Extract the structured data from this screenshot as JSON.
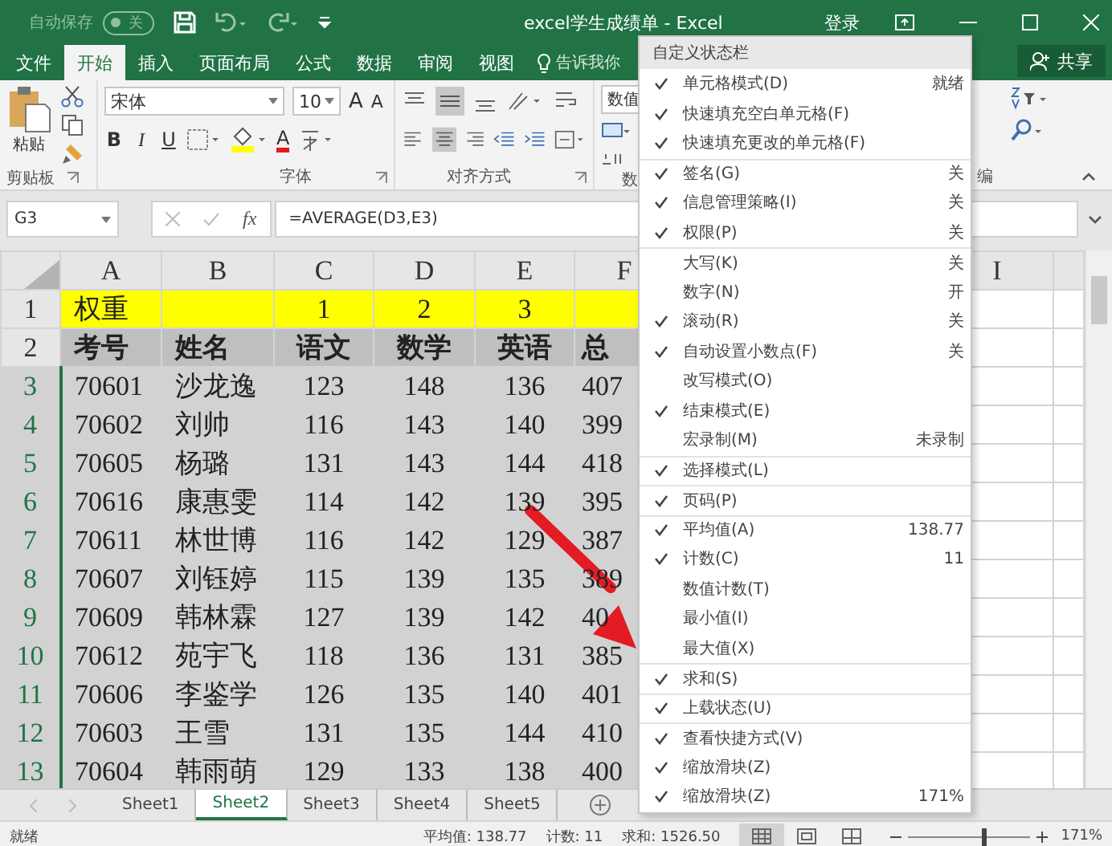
{
  "title_bar": {
    "autosave_label": "自动保存",
    "autosave_state": "关",
    "autosave_on": false,
    "title": "excel学生成绩单  -  Excel",
    "signin": "登录"
  },
  "ribbon_tabs": [
    {
      "label": "文件",
      "selected": false
    },
    {
      "label": "开始",
      "selected": true
    },
    {
      "label": "插入",
      "selected": false
    },
    {
      "label": "页面布局",
      "selected": false
    },
    {
      "label": "公式",
      "selected": false
    },
    {
      "label": "数据",
      "selected": false
    },
    {
      "label": "审阅",
      "selected": false
    },
    {
      "label": "视图",
      "selected": false
    }
  ],
  "tell_me": "告诉我你",
  "share": "共享",
  "ribbon": {
    "paste": "粘贴",
    "font_name": "宋体",
    "font_size": "10",
    "grow": "A",
    "shrink": "A",
    "format_buttons": [
      "B",
      "I",
      "U"
    ],
    "font_color": "A",
    "number_format": "数值",
    "groups": [
      "剪贴板",
      "字体",
      "对齐方式",
      "数"
    ],
    "edit_group": "编"
  },
  "formula_bar": {
    "name_box": "G3",
    "fx": "fx",
    "formula": "=AVERAGE(D3,E3)"
  },
  "sheet": {
    "columns": [
      "A",
      "B",
      "C",
      "D",
      "E",
      "F"
    ],
    "right_column": "I",
    "rows": [
      {
        "header": "1",
        "selected": false,
        "kind": "weight",
        "cells": [
          "权重",
          null,
          "1",
          "2",
          "3",
          null
        ]
      },
      {
        "header": "2",
        "selected": false,
        "kind": "heading",
        "cells": [
          "考号",
          "姓名",
          "语文",
          "数学",
          "英语",
          "总"
        ]
      },
      {
        "header": "3",
        "selected": true,
        "kind": "data",
        "cells": [
          "70601",
          "沙龙逸",
          "123",
          "148",
          "136",
          "407"
        ]
      },
      {
        "header": "4",
        "selected": true,
        "kind": "data",
        "cells": [
          "70602",
          "刘帅",
          "116",
          "143",
          "140",
          "399"
        ]
      },
      {
        "header": "5",
        "selected": true,
        "kind": "data",
        "cells": [
          "70605",
          "杨璐",
          "131",
          "143",
          "144",
          "418"
        ]
      },
      {
        "header": "6",
        "selected": true,
        "kind": "data",
        "cells": [
          "70616",
          "康惠雯",
          "114",
          "142",
          "139",
          "395"
        ]
      },
      {
        "header": "7",
        "selected": true,
        "kind": "data",
        "cells": [
          "70611",
          "林世博",
          "116",
          "142",
          "129",
          "387"
        ]
      },
      {
        "header": "8",
        "selected": true,
        "kind": "data",
        "cells": [
          "70607",
          "刘钰婷",
          "115",
          "139",
          "135",
          "389"
        ]
      },
      {
        "header": "9",
        "selected": true,
        "kind": "data",
        "cells": [
          "70609",
          "韩林霖",
          "127",
          "139",
          "142",
          "40"
        ]
      },
      {
        "header": "10",
        "selected": true,
        "kind": "data",
        "cells": [
          "70612",
          "苑宇飞",
          "118",
          "136",
          "131",
          "385"
        ]
      },
      {
        "header": "11",
        "selected": true,
        "kind": "data",
        "cells": [
          "70606",
          "李鉴学",
          "126",
          "135",
          "140",
          "401"
        ]
      },
      {
        "header": "12",
        "selected": true,
        "kind": "data",
        "cells": [
          "70603",
          "王雪",
          "131",
          "135",
          "144",
          "410"
        ]
      },
      {
        "header": "13",
        "selected": true,
        "kind": "data",
        "cells": [
          "70604",
          "韩雨萌",
          "129",
          "133",
          "138",
          "400"
        ]
      }
    ]
  },
  "sheet_tabs": [
    {
      "label": "Sheet1",
      "selected": false
    },
    {
      "label": "Sheet2",
      "selected": true
    },
    {
      "label": "Sheet3",
      "selected": false
    },
    {
      "label": "Sheet4",
      "selected": false
    },
    {
      "label": "Sheet5",
      "selected": false
    }
  ],
  "status_bar": {
    "mode": "就绪",
    "average": "平均值: 138.77",
    "count": "计数: 11",
    "sum": "求和: 1526.50",
    "views": [
      {
        "kind": "normal",
        "selected": true
      },
      {
        "kind": "layout",
        "selected": false
      },
      {
        "kind": "break",
        "selected": false
      }
    ],
    "zoom": {
      "level": 0.6
    },
    "zoom_label": "171%"
  },
  "context_menu": {
    "title": "自定义状态栏",
    "items": [
      {
        "label": "单元格模式(D)",
        "value": "就绪",
        "checked": true,
        "separator_before": false
      },
      {
        "label": "快速填充空白单元格(F)",
        "checked": true,
        "separator_before": false
      },
      {
        "label": "快速填充更改的单元格(F)",
        "checked": true,
        "separator_before": false
      },
      {
        "label": "签名(G)",
        "value": "关",
        "checked": true,
        "separator_before": true
      },
      {
        "label": "信息管理策略(I)",
        "value": "关",
        "checked": true,
        "separator_before": false
      },
      {
        "label": "权限(P)",
        "value": "关",
        "checked": true,
        "separator_before": false
      },
      {
        "label": "大写(K)",
        "value": "关",
        "checked": false,
        "separator_before": true
      },
      {
        "label": "数字(N)",
        "value": "开",
        "checked": false,
        "separator_before": false
      },
      {
        "label": "滚动(R)",
        "value": "关",
        "checked": true,
        "separator_before": false
      },
      {
        "label": "自动设置小数点(F)",
        "value": "关",
        "checked": true,
        "separator_before": false
      },
      {
        "label": "改写模式(O)",
        "checked": false,
        "separator_before": false
      },
      {
        "label": "结束模式(E)",
        "checked": true,
        "separator_before": false
      },
      {
        "label": "宏录制(M)",
        "value": "未录制",
        "checked": false,
        "separator_before": false
      },
      {
        "label": "选择模式(L)",
        "checked": true,
        "separator_before": true
      },
      {
        "label": "页码(P)",
        "checked": true,
        "separator_before": true
      },
      {
        "label": "平均值(A)",
        "value": "138.77",
        "checked": true,
        "separator_before": true
      },
      {
        "label": "计数(C)",
        "value": "11",
        "checked": true,
        "separator_before": false
      },
      {
        "label": "数值计数(T)",
        "checked": false,
        "separator_before": false
      },
      {
        "label": "最小值(I)",
        "checked": false,
        "separator_before": false
      },
      {
        "label": "最大值(X)",
        "checked": false,
        "separator_before": false
      },
      {
        "label": "求和(S)",
        "checked": true,
        "separator_before": true
      },
      {
        "label": "上载状态(U)",
        "checked": true,
        "separator_before": true
      },
      {
        "label": "查看快捷方式(V)",
        "checked": true,
        "separator_before": true
      },
      {
        "label": "缩放滑块(Z)",
        "checked": true,
        "separator_before": false
      },
      {
        "label": "缩放滑块(Z)",
        "value": "171%",
        "checked": true,
        "separator_before": false
      }
    ]
  }
}
